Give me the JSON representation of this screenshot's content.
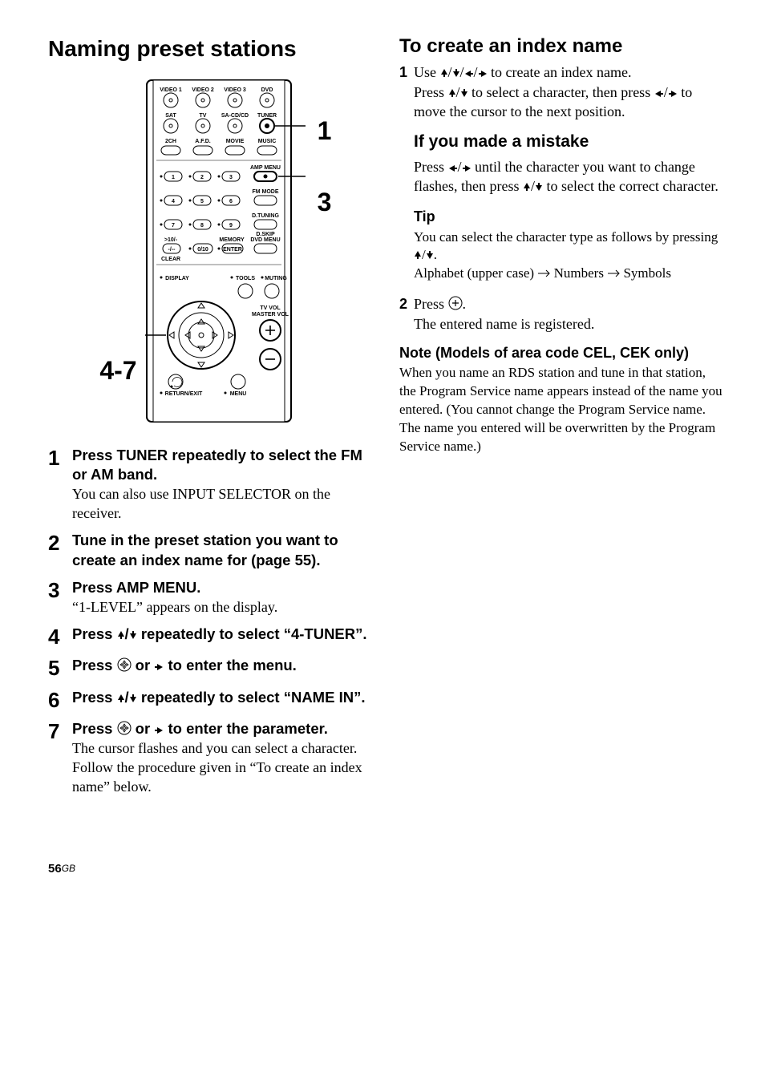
{
  "pageNumber": "56",
  "pageSuffix": "GB",
  "left": {
    "title": "Naming preset stations",
    "calloutLeft": "4-7",
    "calloutRight1": "1",
    "calloutRight3": "3",
    "steps": [
      {
        "num": "1",
        "head": "Press TUNER repeatedly to select the FM or AM band.",
        "body": "You can also use INPUT SELECTOR on the receiver."
      },
      {
        "num": "2",
        "head": "Tune in the preset station you want to create an index name for (page 55).",
        "body": ""
      },
      {
        "num": "3",
        "head": "Press AMP MENU.",
        "body": "“1-LEVEL” appears on the display."
      },
      {
        "num": "4",
        "head_pre": "Press ",
        "head_post": " repeatedly to select “4-TUNER”.",
        "arrows": "ud",
        "body": ""
      },
      {
        "num": "5",
        "head_pre": "Press ",
        "head_mid": " or ",
        "head_post": " to enter the menu.",
        "icon": "enter",
        "arrow2": "r",
        "body": ""
      },
      {
        "num": "6",
        "head_pre": "Press ",
        "head_post": " repeatedly to select “NAME IN”.",
        "arrows": "ud",
        "body": ""
      },
      {
        "num": "7",
        "head_pre": "Press ",
        "head_mid": " or ",
        "head_post": " to enter the parameter.",
        "icon": "enter",
        "arrow2": "r",
        "body": "The cursor flashes and you can select a character. Follow the procedure given in “To create an index name” below."
      }
    ]
  },
  "right": {
    "createTitle": "To create an index name",
    "s1": {
      "num": "1",
      "pre": "Use ",
      "post": " to create an index name.",
      "l2a": "Press ",
      "l2b": " to select a character, then press ",
      "l3b": " to move the cursor to the next position."
    },
    "mistakeTitle": "If you made a mistake",
    "mistakeBody_a": "Press ",
    "mistakeBody_b": " until the character you want to change flashes, then press ",
    "mistakeBody_c": " to select the correct character.",
    "tipTitle": "Tip",
    "tipBody_a": "You can select the character type as follows by pressing ",
    "tipBody_b": ".",
    "tipSeq_a": "Alphabet (upper case) ",
    "tipSeq_b": " Numbers ",
    "tipSeq_c": " Symbols",
    "s2": {
      "num": "2",
      "pre": "Press ",
      "post": ".",
      "body": "The entered name is registered."
    },
    "noteTitle": "Note (Models of area code CEL, CEK only)",
    "noteBody": "When you name an RDS station and tune in that station, the Program Service name appears instead of the name you entered. (You cannot change the Program Service name. The name you entered will be overwritten by the Program Service name.)"
  },
  "remote": {
    "row1": [
      "VIDEO 1",
      "VIDEO 2",
      "VIDEO 3",
      "DVD"
    ],
    "row2": [
      "SAT",
      "TV",
      "SA-CD/CD",
      "TUNER"
    ],
    "row3": [
      "2CH",
      "A.F.D.",
      "MOVIE",
      "MUSIC"
    ],
    "row4_nums": [
      "1",
      "2",
      "3"
    ],
    "row4_side": "AMP MENU",
    "row5_nums": [
      "4",
      "5",
      "6"
    ],
    "row5_side": "FM MODE",
    "row6_nums": [
      "7",
      "8",
      "9"
    ],
    "row6_side": "D.TUNING",
    "row6_side2": "D.SKIP",
    "row7_left": ">10/-\n-/--",
    "row7_left2": "CLEAR",
    "row7_mid": "0/10",
    "row7_memory": "MEMORY",
    "row7_enter": "ENTER",
    "row7_right": "DVD MENU",
    "row8_left": "DISPLAY",
    "row8_mid": "TOOLS",
    "row8_right": "MUTING",
    "tvvol": "TV VOL",
    "mastervol": "MASTER VOL",
    "returnexit": "RETURN/EXIT",
    "menu": "MENU"
  }
}
